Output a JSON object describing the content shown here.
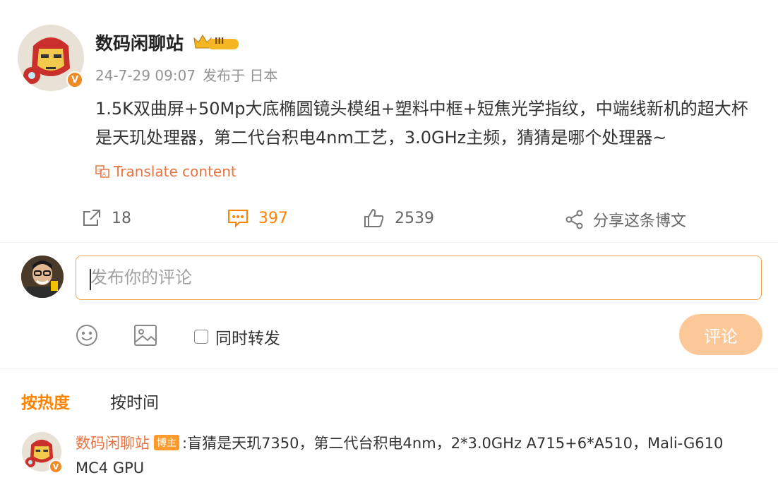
{
  "post": {
    "username": "数码闲聊站",
    "rank_badge": "III",
    "verified_mark": "V",
    "date": "24-7-29 09:07",
    "source": "发布于 日本",
    "text": "1.5K双曲屏+50Mp大底椭圆镜头模组+塑料中框+短焦光学指纹，中端线新机的超大杯是天玑处理器，第二代台积电4nm工艺，3.0GHz主频，猜猜是哪个处理器~",
    "translate_label": "Translate content"
  },
  "actions": {
    "repost_count": "18",
    "comment_count": "397",
    "like_count": "2539",
    "share_label": "分享这条博文"
  },
  "composer": {
    "placeholder": "发布你的评论",
    "repost_label": "同时转发",
    "submit_label": "评论"
  },
  "sort": {
    "hot_label": "按热度",
    "time_label": "按时间"
  },
  "comment": {
    "username": "数码闲聊站",
    "badge": "博主",
    "text_line1": ":盲猜是天玑7350，第二代台积电4nm，2*3.0GHz A715+6*A510，Mali-G610",
    "text_line2": "MC4 GPU"
  },
  "colors": {
    "accent": "#ff8200",
    "link": "#eb7340",
    "submit_disabled": "#fdc898",
    "input_border": "#f0a24a"
  }
}
